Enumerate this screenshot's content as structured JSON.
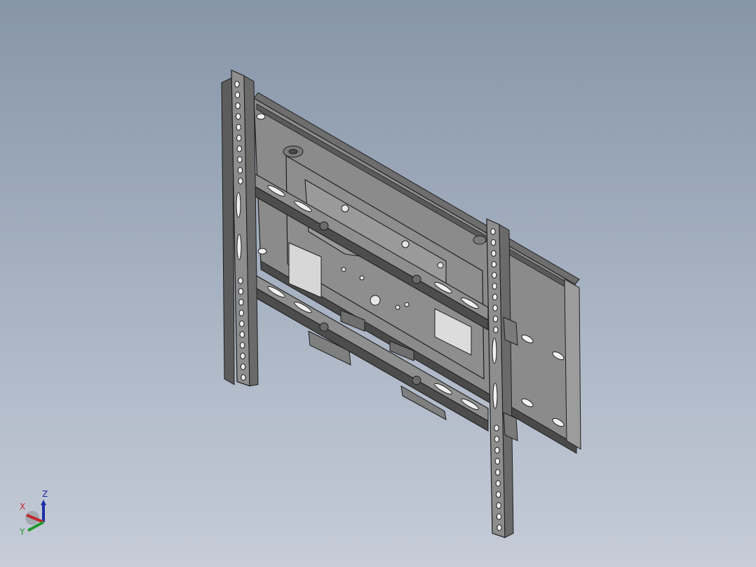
{
  "viewport": {
    "background_top": "#8795a9",
    "background_bottom": "#c6ccd8",
    "model": "tv-wall-mount-bracket",
    "render_style": "shaded-with-edges",
    "model_color": "#8a8a8a",
    "edge_color": "#1e1e1e"
  },
  "triad": {
    "x_label": "X",
    "y_label": "Y",
    "z_label": "Z",
    "x_color": "#c0282d",
    "y_color": "#1f9a2c",
    "z_color": "#1c2fa6"
  }
}
